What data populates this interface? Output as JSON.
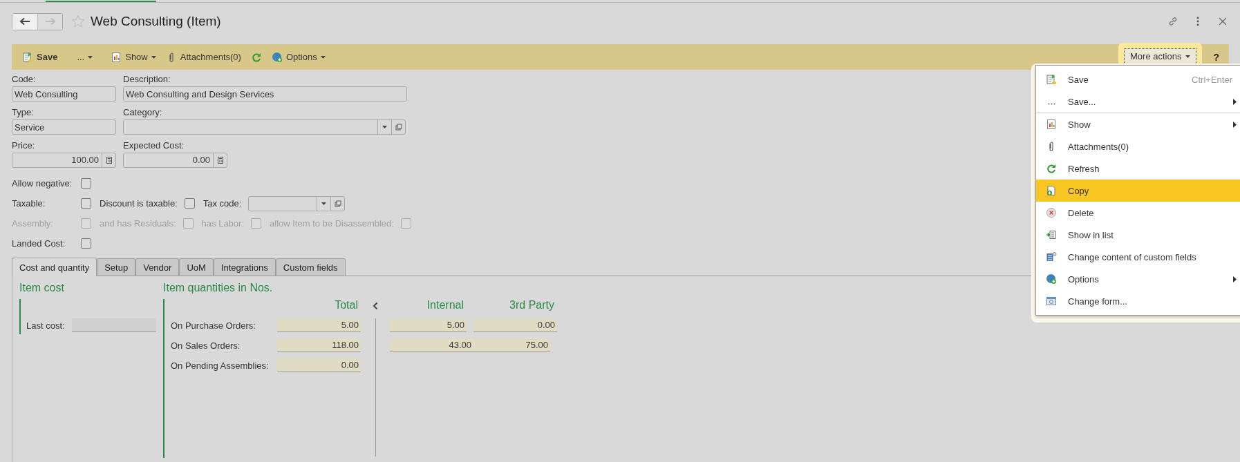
{
  "window": {
    "title": "Web Consulting (Item)"
  },
  "nav": [
    {
      "kind": "back",
      "disabled": false
    },
    {
      "kind": "forward",
      "disabled": true
    }
  ],
  "toolbar": {
    "items": [
      {
        "kind": "save",
        "label": "Save",
        "dropdown": false
      },
      {
        "kind": "more",
        "label": "...",
        "dropdown": true
      },
      {
        "kind": "show",
        "label": "Show",
        "dropdown": true
      },
      {
        "kind": "attachments",
        "label": "Attachments(0)",
        "dropdown": false
      },
      {
        "kind": "refresh",
        "dropdown": false
      },
      {
        "kind": "options",
        "label": "Options",
        "dropdown": true
      }
    ],
    "more_actions": {
      "label": "More actions",
      "expanded": true
    },
    "help": "?"
  },
  "form": {
    "code": {
      "label": "Code:",
      "value": "Web Consulting"
    },
    "description": {
      "label": "Description:",
      "value": "Web Consulting and Design Services"
    },
    "type": {
      "label": "Type:",
      "value": "Service"
    },
    "category": {
      "label": "Category:"
    },
    "price": {
      "label": "Price:",
      "value": "100.00"
    },
    "expected_cost": {
      "label": "Expected Cost:",
      "value": "0.00"
    }
  },
  "flags": [
    {
      "items": [
        {
          "kind": "check",
          "label": "Allow negative:",
          "checked": false,
          "disabled": false
        }
      ]
    },
    {
      "items": [
        {
          "kind": "check",
          "label": "Taxable:",
          "checked": false,
          "disabled": false
        },
        {
          "kind": "check",
          "label": "Discount is taxable:",
          "checked": false,
          "disabled": false
        },
        {
          "kind": "combo",
          "label": "Tax code:"
        }
      ]
    },
    {
      "items": [
        {
          "kind": "check",
          "label": "Assembly:",
          "checked": false,
          "disabled": true
        },
        {
          "kind": "check",
          "label": "and has Residuals:",
          "checked": false,
          "disabled": true
        },
        {
          "kind": "check",
          "label": "has Labor:",
          "checked": false,
          "disabled": true
        },
        {
          "kind": "check",
          "label": "allow Item to be Disassembled:",
          "checked": false,
          "disabled": true
        }
      ]
    },
    {
      "items": [
        {
          "kind": "check",
          "label": "Landed Cost:",
          "checked": false,
          "disabled": false
        }
      ]
    }
  ],
  "tabs": [
    {
      "label": "Cost and quantity",
      "selected": true
    },
    {
      "label": "Setup",
      "selected": false
    },
    {
      "label": "Vendor",
      "selected": false
    },
    {
      "label": "UoM",
      "selected": false
    },
    {
      "label": "Integrations",
      "selected": false
    },
    {
      "label": "Custom fields",
      "selected": false
    }
  ],
  "item_cost": {
    "title": "Item cost",
    "last_cost_label": "Last cost:"
  },
  "quantities": {
    "title": "Item quantities in Nos.",
    "columns": [
      "Total",
      "Internal",
      "3rd Party"
    ],
    "rows": [
      {
        "label": "On Purchase Orders:",
        "total": "5.00",
        "internal": "5.00",
        "third_party": "0.00"
      },
      {
        "label": "On Sales Orders:",
        "total": "118.00",
        "internal": "43.00",
        "third_party": "75.00"
      },
      {
        "label": "On Pending Assemblies:",
        "total": "0.00"
      }
    ]
  },
  "menu": {
    "items": [
      {
        "kind": "save",
        "label": "Save",
        "shortcut": "Ctrl+Enter",
        "submenu": false,
        "selected": false,
        "divider_after": false
      },
      {
        "kind": "dots",
        "label": "Save...",
        "submenu": true,
        "selected": false,
        "divider_after": true
      },
      {
        "kind": "show",
        "label": "Show",
        "submenu": true,
        "selected": false,
        "divider_after": false
      },
      {
        "kind": "clip",
        "label": "Attachments(0)",
        "submenu": false,
        "selected": false,
        "divider_after": false
      },
      {
        "kind": "refresh",
        "label": "Refresh",
        "submenu": false,
        "selected": false,
        "divider_after": false
      },
      {
        "kind": "copy",
        "label": "Copy",
        "submenu": false,
        "selected": true,
        "divider_after": false
      },
      {
        "kind": "delete",
        "label": "Delete",
        "submenu": false,
        "selected": false,
        "divider_after": false
      },
      {
        "kind": "list",
        "label": "Show in list",
        "submenu": false,
        "selected": false,
        "divider_after": false
      },
      {
        "kind": "custom",
        "label": "Change content of custom fields",
        "submenu": false,
        "selected": false,
        "divider_after": false
      },
      {
        "kind": "globe",
        "label": "Options",
        "submenu": true,
        "selected": false,
        "divider_after": false
      },
      {
        "kind": "form",
        "label": "Change form...",
        "submenu": false,
        "selected": false,
        "divider_after": false
      }
    ]
  }
}
